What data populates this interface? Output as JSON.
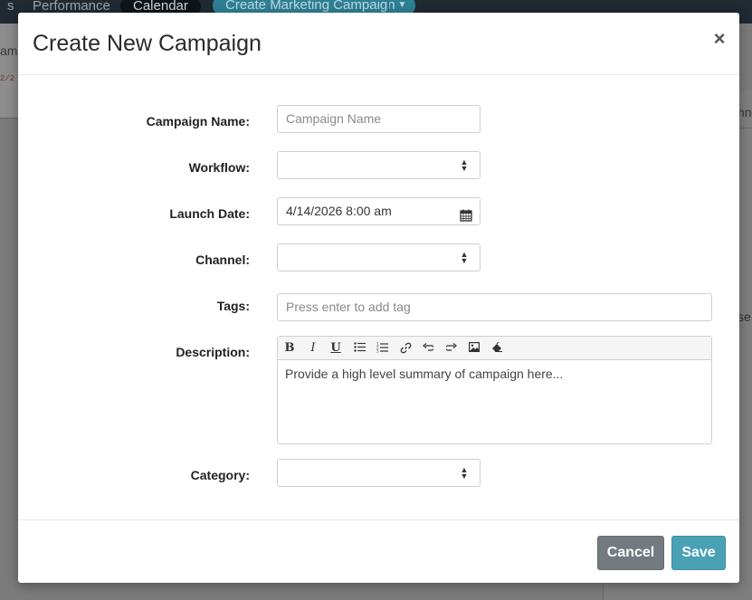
{
  "background": {
    "tabs": [
      "s",
      "Performance",
      "Calendar"
    ],
    "create_button_label": "Create Marketing Campaign",
    "left_text": "am",
    "left_small_text": "2/2",
    "right_text1": "nn",
    "right_text2": "se"
  },
  "modal": {
    "title": "Create New Campaign",
    "close_symbol": "×"
  },
  "form": {
    "campaign_name": {
      "label": "Campaign Name:",
      "placeholder": "Campaign Name",
      "value": ""
    },
    "workflow": {
      "label": "Workflow:",
      "value": ""
    },
    "launch_date": {
      "label": "Launch Date:",
      "value": "4/14/2026 8:00 am"
    },
    "channel": {
      "label": "Channel:",
      "value": ""
    },
    "tags": {
      "label": "Tags:",
      "placeholder": "Press enter to add tag"
    },
    "description": {
      "label": "Description:",
      "placeholder": "Provide a high level summary of campaign here...",
      "toolbar": [
        "bold-icon",
        "italic-icon",
        "underline-icon",
        "bullet-list-icon",
        "numbered-list-icon",
        "link-icon",
        "undo-icon",
        "redo-icon",
        "image-icon",
        "eraser-icon"
      ]
    },
    "category": {
      "label": "Category:",
      "value": ""
    }
  },
  "footer": {
    "cancel_label": "Cancel",
    "save_label": "Save"
  },
  "colors": {
    "cancel": "#737a80",
    "save": "#4aa0b5",
    "topbar": "#1f2a33"
  }
}
